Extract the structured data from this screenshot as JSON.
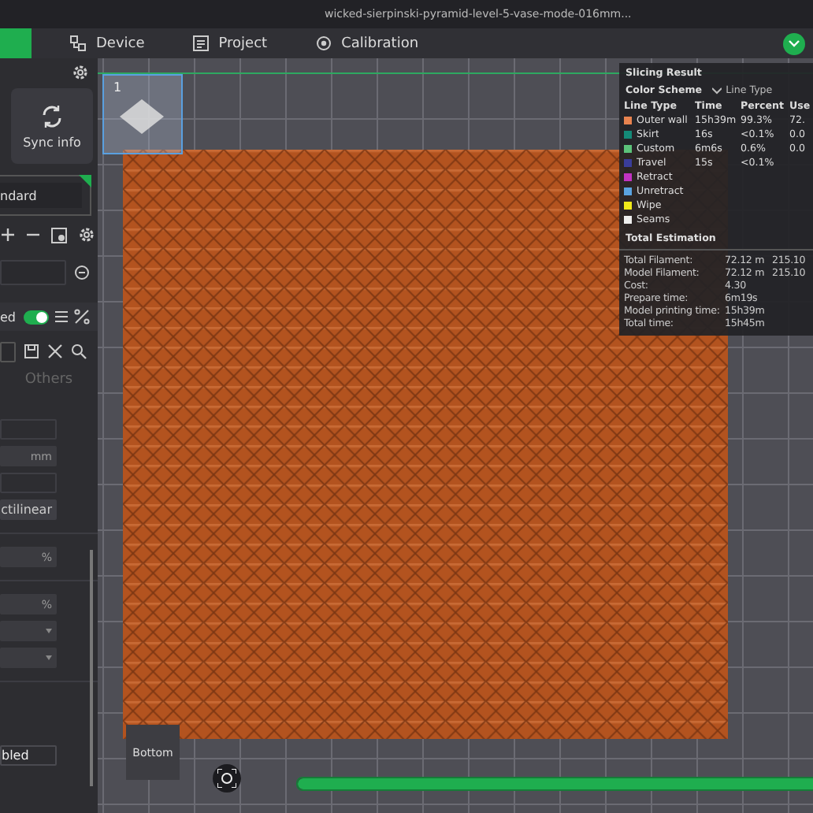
{
  "window": {
    "title": "wicked-sierpinski-pyramid-level-5-vase-mode-016mm..."
  },
  "tabs": [
    {
      "label": "Device",
      "selected": false
    },
    {
      "label": "Project",
      "selected": false
    },
    {
      "label": "Calibration",
      "selected": false
    }
  ],
  "left_panel": {
    "sync_button": {
      "label": "Sync info"
    },
    "preset": {
      "value": "ndard"
    },
    "toggle": {
      "label": "ed",
      "on": true
    },
    "section_tab": {
      "label": "Others"
    },
    "field_groups": [
      [
        {
          "kind": "blank"
        },
        {
          "kind": "unit",
          "text": "mm"
        },
        {
          "kind": "blank"
        },
        {
          "kind": "select",
          "text": "ctilinear"
        }
      ],
      [
        {
          "kind": "unit",
          "text": "%"
        }
      ],
      [
        {
          "kind": "unit",
          "text": "%"
        },
        {
          "kind": "dropdown"
        },
        {
          "kind": "dropdown"
        }
      ],
      [
        {
          "kind": "value",
          "text": "bled"
        }
      ]
    ]
  },
  "plate": {
    "number": "1"
  },
  "view_cube": {
    "label": "Bottom"
  },
  "layer_slider": {
    "level": 1
  },
  "slicing_result": {
    "title": "Slicing Result",
    "color_scheme": {
      "label": "Color Scheme",
      "value": "Line Type"
    },
    "columns": [
      "Line Type",
      "Time",
      "Percent",
      "Use"
    ],
    "rows": [
      {
        "name": "Outer wall",
        "color": "#e8834f",
        "time": "15h39m",
        "percent": "99.3%",
        "used": "72."
      },
      {
        "name": "Skirt",
        "color": "#148a78",
        "time": "16s",
        "percent": "<0.1%",
        "used": "0.0"
      },
      {
        "name": "Custom",
        "color": "#5cc27a",
        "time": "6m6s",
        "percent": "0.6%",
        "used": "0.0"
      },
      {
        "name": "Travel",
        "color": "#3a3d9a",
        "time": "15s",
        "percent": "<0.1%"
      },
      {
        "name": "Retract",
        "color": "#c233c2"
      },
      {
        "name": "Unretract",
        "color": "#5aa3e0"
      },
      {
        "name": "Wipe",
        "color": "#f0ea1a"
      },
      {
        "name": "Seams",
        "color": "#eeeeee"
      }
    ],
    "total_title": "Total Estimation",
    "totals": [
      {
        "label": "Total Filament:",
        "value": "72.12 m",
        "extra": "215.10"
      },
      {
        "label": "Model Filament:",
        "value": "72.12 m",
        "extra": "215.10"
      },
      {
        "label": "Cost:",
        "value": "4.30"
      },
      {
        "label": "Prepare time:",
        "value": "6m19s"
      },
      {
        "label": "Model printing time:",
        "value": "15h39m"
      },
      {
        "label": "Total time:",
        "value": "15h45m"
      }
    ]
  }
}
